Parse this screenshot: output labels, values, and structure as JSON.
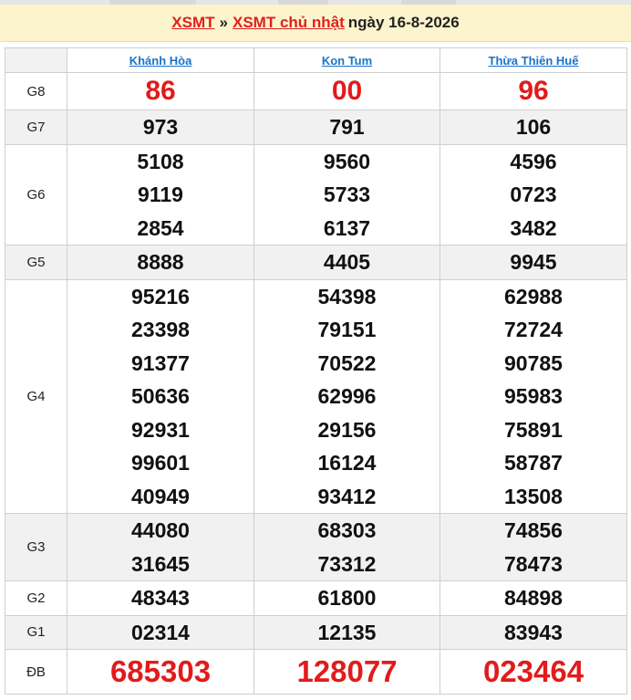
{
  "header": {
    "link1": "XSMT",
    "separator": "»",
    "link2": "XSMT chủ nhật",
    "date_text": "ngày 16-8-2026"
  },
  "provinces": [
    "Khánh Hòa",
    "Kon Tum",
    "Thừa Thiên Huế"
  ],
  "prizes": [
    {
      "label": "G8",
      "values": [
        [
          "86"
        ],
        [
          "00"
        ],
        [
          "96"
        ]
      ]
    },
    {
      "label": "G7",
      "values": [
        [
          "973"
        ],
        [
          "791"
        ],
        [
          "106"
        ]
      ]
    },
    {
      "label": "G6",
      "values": [
        [
          "5108",
          "9119",
          "2854"
        ],
        [
          "9560",
          "5733",
          "6137"
        ],
        [
          "4596",
          "0723",
          "3482"
        ]
      ]
    },
    {
      "label": "G5",
      "values": [
        [
          "8888"
        ],
        [
          "4405"
        ],
        [
          "9945"
        ]
      ]
    },
    {
      "label": "G4",
      "values": [
        [
          "95216",
          "23398",
          "91377",
          "50636",
          "92931",
          "99601",
          "40949"
        ],
        [
          "54398",
          "79151",
          "70522",
          "62996",
          "29156",
          "16124",
          "93412"
        ],
        [
          "62988",
          "72724",
          "90785",
          "95983",
          "75891",
          "58787",
          "13508"
        ]
      ]
    },
    {
      "label": "G3",
      "values": [
        [
          "44080",
          "31645"
        ],
        [
          "68303",
          "73312"
        ],
        [
          "74856",
          "78473"
        ]
      ]
    },
    {
      "label": "G2",
      "values": [
        [
          "48343"
        ],
        [
          "61800"
        ],
        [
          "84898"
        ]
      ]
    },
    {
      "label": "G1",
      "values": [
        [
          "02314"
        ],
        [
          "12135"
        ],
        [
          "83943"
        ]
      ]
    },
    {
      "label": "ĐB",
      "values": [
        [
          "685303"
        ],
        [
          "128077"
        ],
        [
          "023464"
        ]
      ]
    }
  ]
}
